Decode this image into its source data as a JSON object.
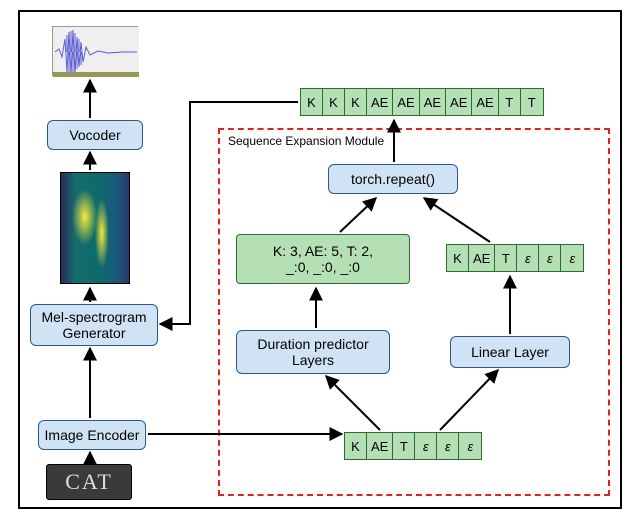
{
  "left": {
    "cat_text": "CAT",
    "image_encoder": "Image Encoder",
    "mel_generator": "Mel-spectrogram\nGenerator",
    "vocoder": "Vocoder"
  },
  "seq": {
    "module_label": "Sequence Expansion Module",
    "torch_repeat": "torch.repeat()",
    "duration_predictor": "Duration predictor\nLayers",
    "linear_layer": "Linear Layer",
    "durations_text": "K: 3, AE: 5, T: 2,\n_:0,  _:0,  _:0"
  },
  "tokens": {
    "expanded": [
      "K",
      "K",
      "K",
      "AE",
      "AE",
      "AE",
      "AE",
      "AE",
      "T",
      "T"
    ],
    "linear_out": [
      "K",
      "AE",
      "T",
      "ε",
      "ε",
      "ε"
    ],
    "input": [
      "K",
      "AE",
      "T",
      "ε",
      "ε",
      "ε"
    ]
  }
}
